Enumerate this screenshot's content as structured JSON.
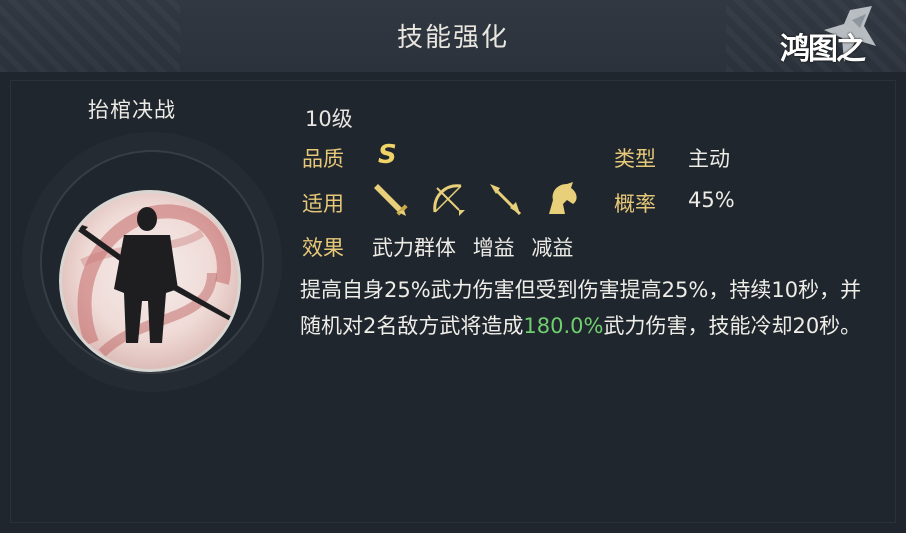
{
  "header": {
    "title": "技能强化",
    "logo_text": "鸿图之下"
  },
  "skill": {
    "name": "抬棺决战",
    "level": "10级",
    "quality_label": "品质",
    "quality_value": "S",
    "type_label": "类型",
    "type_value": "主动",
    "apply_label": "适用",
    "apply_icons": [
      "sword-icon",
      "bow-icon",
      "spear-icon",
      "horse-icon"
    ],
    "rate_label": "概率",
    "rate_value": "45%",
    "effect_label": "效果",
    "effect_tags": [
      "武力群体",
      "增益",
      "减益"
    ],
    "description": {
      "part1": "提高自身25%武力伤害但受到伤害提高25%，持续10秒，并随机对2名敌方武将造成",
      "highlight": "180.0%",
      "part2": "武力伤害，技能冷却20秒。"
    }
  },
  "colors": {
    "label": "#e6c879",
    "text": "#ecebe6",
    "highlight": "#6fcf6f",
    "quality": "#f0d468"
  }
}
